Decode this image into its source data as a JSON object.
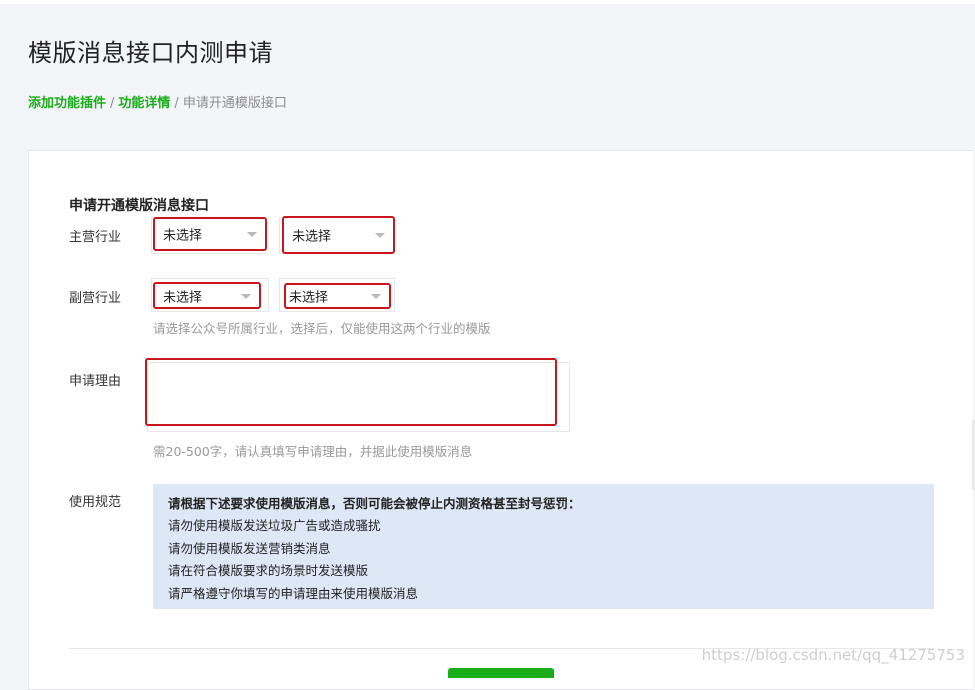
{
  "page": {
    "title": "模版消息接口内测申请"
  },
  "breadcrumb": {
    "items": [
      {
        "label": "添加功能插件",
        "link": true
      },
      {
        "label": "功能详情",
        "link": true
      },
      {
        "label": "申请开通模版接口",
        "link": false
      }
    ],
    "separator": "/"
  },
  "form": {
    "section_title": "申请开通模版消息接口",
    "primary_industry": {
      "label": "主营行业",
      "select1": "未选择",
      "select2": "未选择"
    },
    "secondary_industry": {
      "label": "副营行业",
      "select1": "未选择",
      "select2": "未选择",
      "hint": "请选择公众号所属行业，选择后，仅能使用这两个行业的模版"
    },
    "reason": {
      "label": "申请理由",
      "value": "",
      "hint": "需20-500字，请认真填写申请理由，并据此使用模版消息"
    },
    "usage_rules": {
      "label": "使用规范",
      "heading": "请根据下述要求使用模版消息，否则可能会被停止内测资格甚至封号惩罚：",
      "items": [
        "请勿使用模版发送垃圾广告或造成骚扰",
        "请勿使用模版发送营销类消息",
        "请在符合模版要求的场景时发送模版",
        "请严格遵守你填写的申请理由来使用模版消息"
      ]
    }
  },
  "watermark": "https://blog.csdn.net/qq_41275753",
  "colors": {
    "accent_green": "#1aad19",
    "highlight_red": "#c9151e",
    "notice_bg": "#dde7f5"
  }
}
